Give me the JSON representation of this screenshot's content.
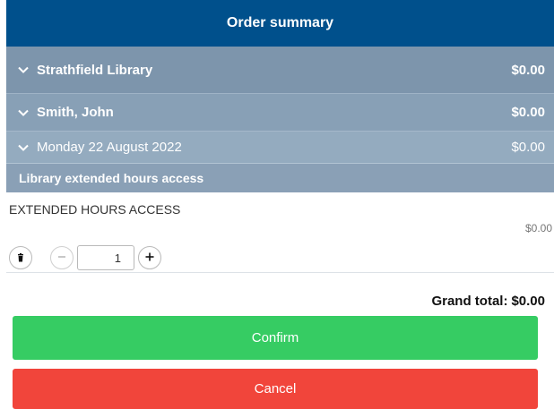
{
  "header": {
    "title": "Order summary"
  },
  "groups": {
    "library": {
      "label": "Strathfield Library",
      "total": "$0.00"
    },
    "person": {
      "label": "Smith, John",
      "total": "$0.00"
    },
    "date": {
      "label": "Monday 22 August 2022",
      "total": "$0.00"
    },
    "service": {
      "label": "Library extended hours access"
    }
  },
  "item": {
    "name": "EXTENDED HOURS ACCESS",
    "price": "$0.00",
    "quantity": "1"
  },
  "summary": {
    "grand_total_label": "Grand total:",
    "grand_total_value": "$0.00"
  },
  "actions": {
    "confirm_label": "Confirm",
    "cancel_label": "Cancel"
  },
  "colors": {
    "header": "#00508c",
    "confirm": "#36cc63",
    "cancel": "#f1453b"
  }
}
